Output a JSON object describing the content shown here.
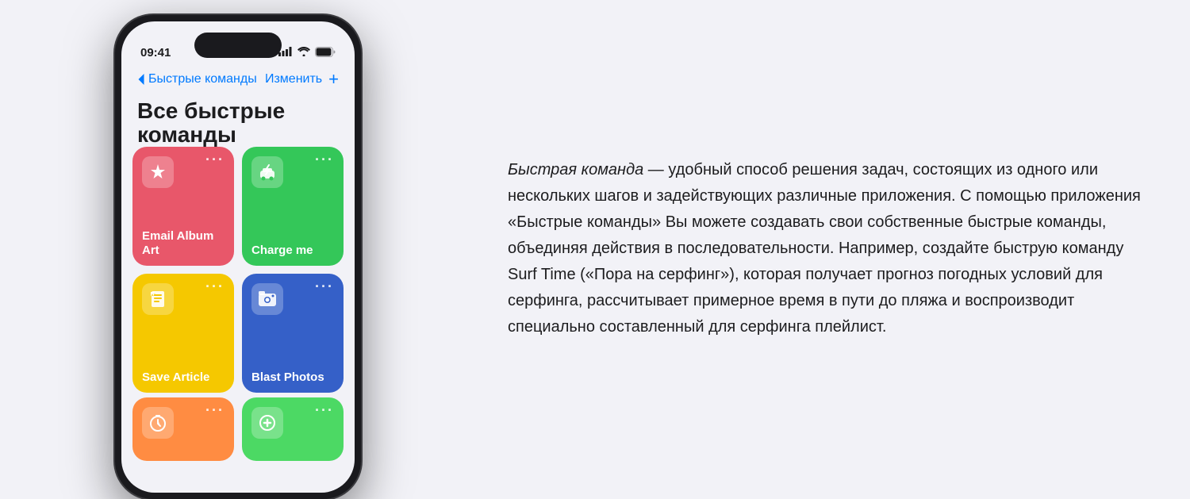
{
  "phone": {
    "status_bar": {
      "time": "09:41",
      "signal_icon": "📶",
      "wifi_icon": "WiFi",
      "battery_icon": "🔋"
    },
    "nav": {
      "back_label": "Быстрые команды",
      "edit_label": "Изменить",
      "add_icon": "+"
    },
    "title": "Все быстрые команды",
    "shortcuts": [
      {
        "id": "email-album-art",
        "label": "Email Album Art",
        "color": "red",
        "icon": "✳️"
      },
      {
        "id": "charge-me",
        "label": "Charge me",
        "color": "green",
        "icon": "⚡"
      },
      {
        "id": "save-article",
        "label": "Save Article",
        "color": "yellow",
        "icon": "📋"
      },
      {
        "id": "blast-photos",
        "label": "Blast Photos",
        "color": "blue",
        "icon": "🖼️"
      }
    ],
    "bottom_shortcuts": [
      {
        "id": "timer",
        "color": "orange",
        "icon": "⏱"
      },
      {
        "id": "add-shortcut",
        "color": "green2",
        "icon": "➕"
      }
    ]
  },
  "description": {
    "text_html": "<em>Быстрая команда</em> — удобный способ решения задач, состоящих из одного или нескольких шагов и задействующих различные приложения. С помощью приложения «Быстрые команды» Вы можете создавать свои собственные быстрые команды, объединяя действия в последовательности. Например, создайте быструю команду Surf Time («Пора на серфинг»), которая получает прогноз погодных условий для серфинга, рассчитывает примерное время в пути до пляжа и воспроизводит специально составленный для серфинга плейлист."
  }
}
